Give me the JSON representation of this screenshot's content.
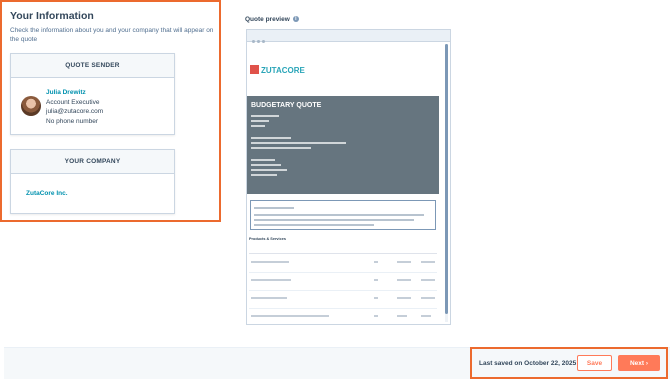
{
  "info": {
    "title": "Your Information",
    "description": "Check the information about you and your company that will appear on the quote"
  },
  "sender": {
    "header": "QUOTE SENDER",
    "name": "Julia Drewitz",
    "role": "Account Executive",
    "email": "julia@zutacore.com",
    "phone": "No phone number"
  },
  "company": {
    "header": "YOUR COMPANY",
    "name": "ZutaCore Inc."
  },
  "preview": {
    "label": "Quote preview",
    "logo_text": "ZUTACORE",
    "doc_title": "BUDGETARY QUOTE",
    "products_label": "Products & Services"
  },
  "footer": {
    "saved_text": "Last saved on October 22, 2025",
    "save_label": "Save",
    "next_label": "Next",
    "next_icon": "›"
  },
  "colors": {
    "accent": "#ff7a59",
    "highlight": "#ec6a2e",
    "link": "#0091ae"
  }
}
